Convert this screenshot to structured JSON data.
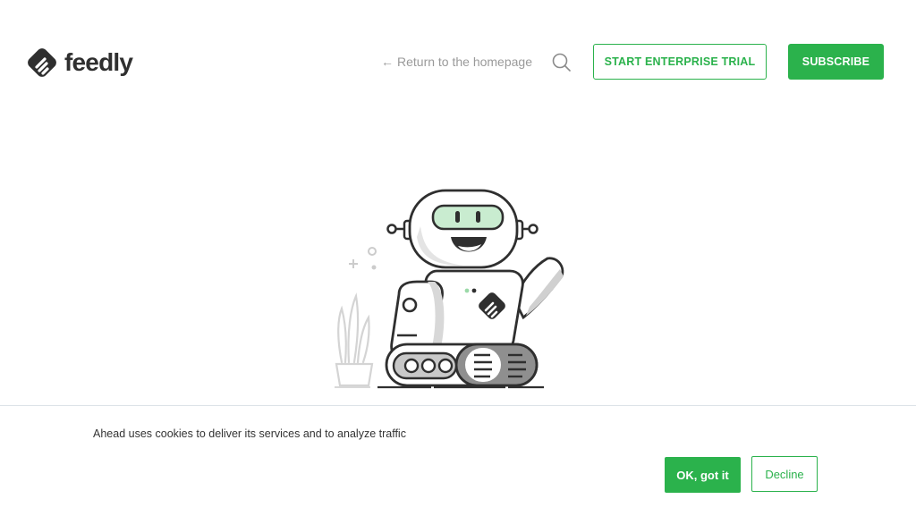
{
  "header": {
    "logo_text": "feedly",
    "return_arrow": "←",
    "return_label": "Return to the homepage",
    "search_icon": "search-icon",
    "enterprise_button": "START ENTERPRISE TRIAL",
    "subscribe_button": "SUBSCRIBE"
  },
  "illustration": {
    "name": "robot-illustration"
  },
  "cookie_banner": {
    "message": "Ahead uses cookies to deliver its services and to analyze traffic",
    "ok_button": "OK, got it",
    "decline_button": "Decline"
  },
  "colors": {
    "brand_green": "#2bb24c",
    "logo_dark": "#2f2f2f",
    "muted_text": "#9a9a9a",
    "robot_visor": "#c9ecd0"
  }
}
